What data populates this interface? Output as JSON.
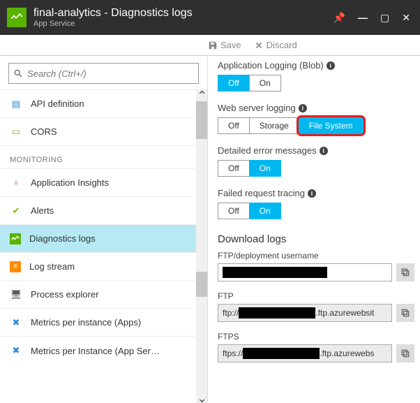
{
  "header": {
    "title": "final-analytics - Diagnostics logs",
    "subtitle": "App Service"
  },
  "toolbar": {
    "save": "Save",
    "discard": "Discard"
  },
  "search": {
    "placeholder": "Search (Ctrl+/)"
  },
  "nav": {
    "items_top": [
      {
        "label": "API definition"
      },
      {
        "label": "CORS"
      }
    ],
    "section": "MONITORING",
    "items_mon": [
      {
        "label": "Application Insights"
      },
      {
        "label": "Alerts"
      },
      {
        "label": "Diagnostics logs"
      },
      {
        "label": "Log stream"
      },
      {
        "label": "Process explorer"
      },
      {
        "label": "Metrics per instance (Apps)"
      },
      {
        "label": "Metrics per Instance (App Ser…"
      }
    ]
  },
  "settings": {
    "appLogging": {
      "label": "Application Logging (Blob)",
      "off": "Off",
      "on": "On"
    },
    "webServer": {
      "label": "Web server logging",
      "off": "Off",
      "storage": "Storage",
      "fs": "File System"
    },
    "detailed": {
      "label": "Detailed error messages",
      "off": "Off",
      "on": "On"
    },
    "failed": {
      "label": "Failed request tracing",
      "off": "Off",
      "on": "On"
    }
  },
  "download": {
    "heading": "Download logs",
    "username_label": "FTP/deployment username",
    "ftp_label": "FTP",
    "ftp_prefix": "ftp://",
    "ftp_suffix": ".ftp.azurewebsit",
    "ftps_label": "FTPS",
    "ftps_prefix": "ftps://",
    "ftps_suffix": ".ftp.azurewebs"
  }
}
